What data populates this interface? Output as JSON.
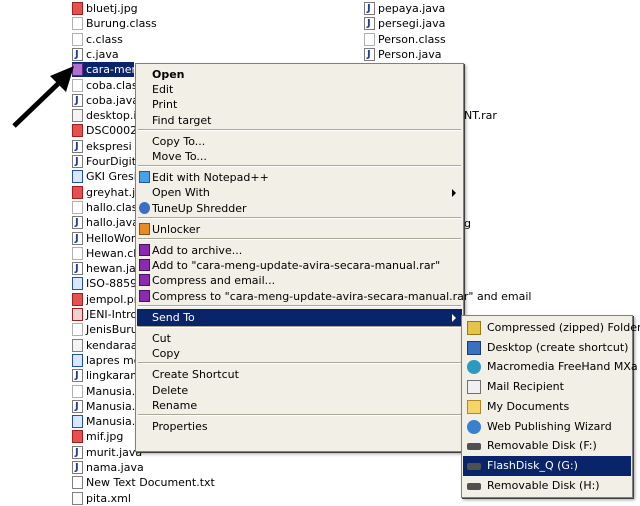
{
  "files_left": [
    {
      "name": "bluetj.jpg",
      "icon": "image-icon"
    },
    {
      "name": "Burung.class",
      "icon": "class-file-icon"
    },
    {
      "name": "c.class",
      "icon": "class-file-icon"
    },
    {
      "name": "c.java",
      "icon": "java-file-icon"
    },
    {
      "name": "cara-meng",
      "icon": "rar-file-icon",
      "selected": true
    },
    {
      "name": "coba.class",
      "icon": "class-file-icon"
    },
    {
      "name": "coba.java",
      "icon": "java-file-icon"
    },
    {
      "name": "desktop.ini",
      "icon": "generic-file-icon"
    },
    {
      "name": "DSC00023.",
      "icon": "image-icon"
    },
    {
      "name": "ekspresi wa",
      "icon": "java-file-icon"
    },
    {
      "name": "FourDigitN",
      "icon": "java-file-icon"
    },
    {
      "name": "GKI Gresik.",
      "icon": "doc-file-icon"
    },
    {
      "name": "greyhat.jpe",
      "icon": "image-icon"
    },
    {
      "name": "hallo.class",
      "icon": "class-file-icon"
    },
    {
      "name": "hallo.java",
      "icon": "java-file-icon"
    },
    {
      "name": "HelloWorld",
      "icon": "java-file-icon"
    },
    {
      "name": "Hewan.clas",
      "icon": "class-file-icon"
    },
    {
      "name": "hewan.java",
      "icon": "java-file-icon"
    },
    {
      "name": "ISO-8859-",
      "icon": "doc-file-icon"
    },
    {
      "name": "jempol.png",
      "icon": "image-icon"
    },
    {
      "name": "JENI-Intro",
      "icon": "pdf-file-icon"
    },
    {
      "name": "JenisBurun",
      "icon": "class-file-icon"
    },
    {
      "name": "kendaraan",
      "icon": "generic-file-icon"
    },
    {
      "name": "lapres mod",
      "icon": "doc-file-icon"
    },
    {
      "name": "lingkaran.",
      "icon": "java-file-icon"
    },
    {
      "name": "Manusia.cla",
      "icon": "class-file-icon"
    },
    {
      "name": "Manusia.ja",
      "icon": "java-file-icon"
    },
    {
      "name": "Manusia.xn",
      "icon": "doc-file-icon"
    },
    {
      "name": "mif.jpg",
      "icon": "image-icon"
    },
    {
      "name": "murit.java",
      "icon": "java-file-icon"
    },
    {
      "name": "nama.java",
      "icon": "java-file-icon"
    },
    {
      "name": "New Text Document.txt",
      "icon": "text-file-icon"
    },
    {
      "name": "pita.xml",
      "icon": "xml-file-icon"
    }
  ],
  "files_right": [
    {
      "name": "pepaya.java",
      "icon": "java-file-icon"
    },
    {
      "name": "persegi.java",
      "icon": "java-file-icon"
    },
    {
      "name": "Person.class",
      "icon": "class-file-icon"
    },
    {
      "name": "Person.java",
      "icon": "java-file-icon"
    }
  ],
  "files_right_partial": [
    {
      "name": "NT.rar"
    },
    {
      "name": "g"
    }
  ],
  "context_menu": {
    "groups": [
      [
        {
          "label": "Open",
          "bold": true
        },
        {
          "label": "Edit"
        },
        {
          "label": "Print"
        },
        {
          "label": "Find target"
        }
      ],
      [
        {
          "label": "Copy To..."
        },
        {
          "label": "Move To..."
        }
      ],
      [
        {
          "label": "Edit with Notepad++",
          "icon": "notepad-plus-plus-icon"
        },
        {
          "label": "Open With",
          "submenu": true
        },
        {
          "label": "TuneUp Shredder",
          "icon": "tuneup-shredder-icon"
        }
      ],
      [
        {
          "label": "Unlocker",
          "icon": "unlocker-icon"
        }
      ],
      [
        {
          "label": "Add to archive...",
          "icon": "winrar-icon"
        },
        {
          "label": "Add to \"cara-meng-update-avira-secara-manual.rar\"",
          "icon": "winrar-icon"
        },
        {
          "label": "Compress and email...",
          "icon": "winrar-icon"
        },
        {
          "label": "Compress to \"cara-meng-update-avira-secara-manual.rar\" and email",
          "icon": "winrar-icon"
        }
      ],
      [
        {
          "label": "Send To",
          "submenu": true,
          "highlighted": true
        }
      ],
      [
        {
          "label": "Cut"
        },
        {
          "label": "Copy"
        }
      ],
      [
        {
          "label": "Create Shortcut"
        },
        {
          "label": "Delete"
        },
        {
          "label": "Rename"
        }
      ],
      [
        {
          "label": "Properties"
        }
      ]
    ]
  },
  "send_to_menu": [
    {
      "label": "Compressed (zipped) Folder",
      "icon": "zip-folder-icon"
    },
    {
      "label": "Desktop (create shortcut)",
      "icon": "desktop-icon"
    },
    {
      "label": "Macromedia FreeHand MXa",
      "icon": "freehand-icon"
    },
    {
      "label": "Mail Recipient",
      "icon": "mail-icon"
    },
    {
      "label": "My Documents",
      "icon": "my-documents-icon"
    },
    {
      "label": "Web Publishing Wizard",
      "icon": "web-publishing-icon"
    },
    {
      "label": "Removable Disk (F:)",
      "icon": "removable-disk-icon"
    },
    {
      "label": "FlashDisk_Q (G:)",
      "icon": "removable-disk-icon",
      "highlighted": true
    },
    {
      "label": "Removable Disk (H:)",
      "icon": "removable-disk-icon"
    }
  ]
}
